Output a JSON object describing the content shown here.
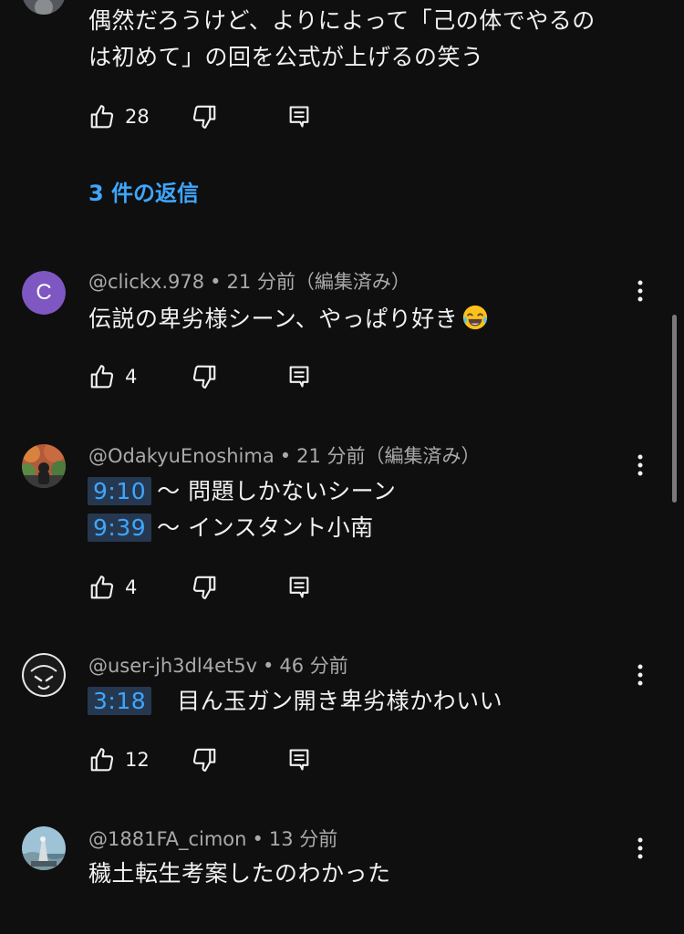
{
  "top_comment": {
    "text_lines": [
      "偶然だろうけど、よりによって「己の体でやるの",
      "は初めて」の回を公式が上げるの笑う"
    ],
    "likes": "28",
    "replies_link": "3 件の返信"
  },
  "comments": [
    {
      "author": "@clickx.978",
      "time": "21 分前（編集済み）",
      "avatar_letter": "C",
      "avatar_color": "#7e57c2",
      "text": "伝説の卑劣様シーン、やっぱり好き",
      "emoji": "face-with-tears-of-joy",
      "likes": "4"
    },
    {
      "author": "@OdakyuEnoshima",
      "time": "21 分前（編集済み）",
      "lines": [
        {
          "ts": "9:10",
          "text": "〜 問題しかないシーン"
        },
        {
          "ts": "9:39",
          "text": "〜 インスタント小南"
        }
      ],
      "likes": "4"
    },
    {
      "author": "@user-jh3dl4et5v",
      "time": "46 分前",
      "ts": "3:18",
      "text": "目ん玉ガン開き卑劣様かわいい",
      "likes": "12"
    },
    {
      "author": "@1881FA_cimon",
      "time": "13 分前",
      "text": "穢土転生考案したのわかった"
    }
  ],
  "meta_separator": "•",
  "icons": {
    "like": "thumbs-up-icon",
    "dislike": "thumbs-down-icon",
    "reply": "reply-comment-icon",
    "more": "more-vertical-icon"
  },
  "colors": {
    "background": "#0f0f0f",
    "link_blue": "#3ea6ff",
    "timestamp_bg": "#263850",
    "meta_gray": "#aaaaaa"
  }
}
